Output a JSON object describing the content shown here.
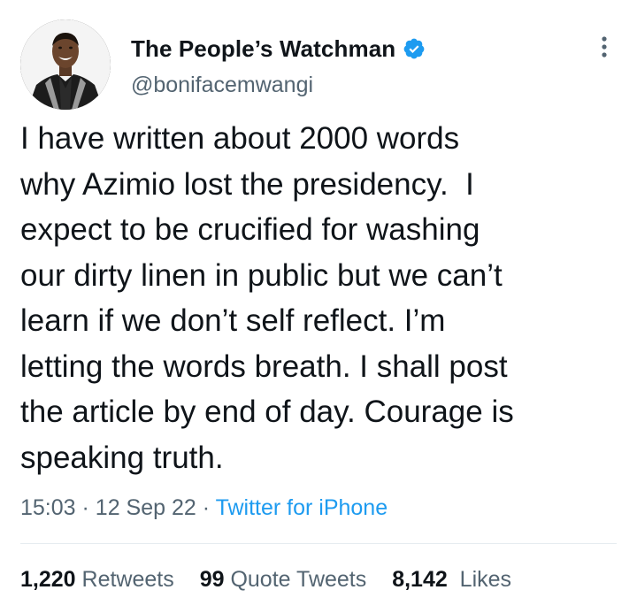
{
  "author": {
    "display_name": "The People’s Watchman",
    "handle": "@bonifacemwangi",
    "avatar_icon": "profile-photo",
    "verified_icon": "verified-badge-icon"
  },
  "tweet": {
    "text": "I have written about 2000 words\nwhy Azimio lost the presidency.  I\nexpect to be crucified for washing\nour dirty linen in public but we can’t\nlearn if we don’t self reflect. I’m\nletting the words breath. I shall post\nthe article by end of day. Courage is\nspeaking truth.",
    "time": "15:03",
    "date": "12 Sep 22",
    "separator": "·",
    "source": "Twitter for iPhone"
  },
  "stats": {
    "retweets_count": "1,220",
    "retweets_label": "Retweets",
    "quotes_count": "99",
    "quotes_label": "Quote Tweets",
    "likes_count": "8,142",
    "likes_label": "Likes"
  },
  "colors": {
    "text": "#0f1419",
    "secondary": "#536471",
    "link": "#1d9bf0",
    "verified": "#1d9bf0",
    "divider": "#e6ecf0"
  }
}
